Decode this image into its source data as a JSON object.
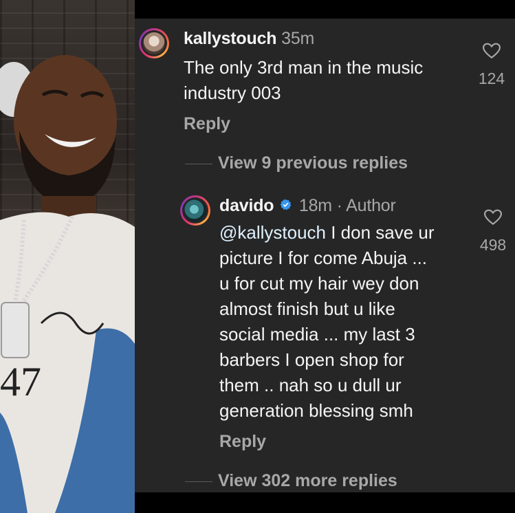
{
  "comments": [
    {
      "username": "kallystouch",
      "time": "35m",
      "lines": [
        "The only 3rd man in the music",
        "industry 003"
      ],
      "reply_label": "Reply",
      "likes": "124",
      "avatar_icon": "user-avatar"
    },
    {
      "username": "davido",
      "verified_icon": "verified-badge-icon",
      "time": "18m",
      "role": "· Author",
      "mention": "@kallystouch",
      "lines_first_rest": " I don save ur",
      "lines": [
        "picture I for come Abuja ...",
        "u for cut my hair wey don",
        "almost finish but u like",
        "social media ... my last 3",
        "barbers I open shop for",
        "them .. nah so u dull ur",
        "generation blessing smh"
      ],
      "reply_label": "Reply",
      "likes": "498",
      "avatar_icon": "user-avatar"
    }
  ],
  "view_previous": "View 9 previous replies",
  "view_more": "View 302 more replies",
  "colors": {
    "panel_bg": "#262626",
    "text": "#f5f5f5",
    "muted": "#a8a8a8",
    "verified": "#3897f0"
  }
}
